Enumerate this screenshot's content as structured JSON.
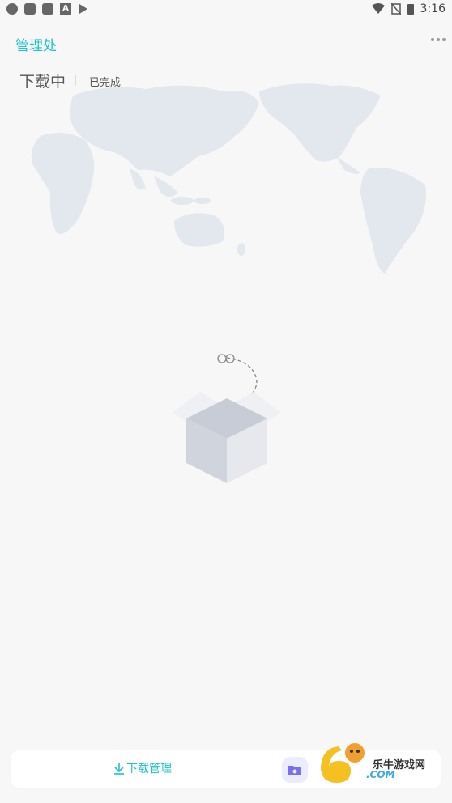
{
  "status_bar": {
    "time": "3:16"
  },
  "header": {
    "title": "管理处"
  },
  "tabs": [
    {
      "label": "下载中"
    },
    {
      "label": "已完成"
    }
  ],
  "bottom_bar": {
    "download_manage_label": "下载管理"
  },
  "watermark": {
    "brand_cn": "乐牛游戏网",
    "brand_en": ".COM"
  },
  "colors": {
    "accent": "#1ec4c6",
    "background": "#f7f7f7",
    "map": "#e3e8ee"
  }
}
